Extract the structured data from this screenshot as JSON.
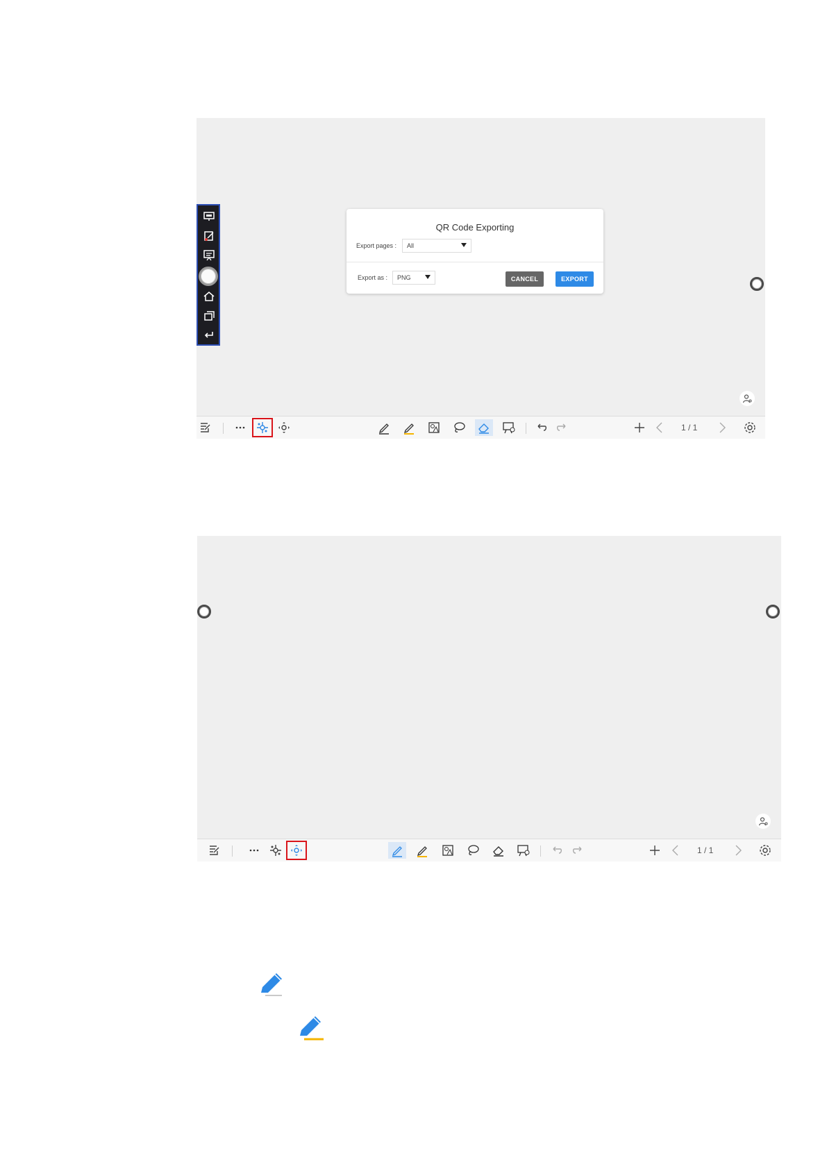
{
  "dialog": {
    "title": "QR Code Exporting",
    "export_pages_label": "Export pages :",
    "export_pages_value": "All",
    "export_as_label": "Export as :",
    "export_as_value": "PNG",
    "cancel_label": "CANCEL",
    "export_label": "EXPORT"
  },
  "toolbar": {
    "page_indicator": "1 / 1"
  },
  "colors": {
    "canvas": "#efefef",
    "accent_blue": "#2e8ae6",
    "highlight_red": "#d9141a",
    "sidebar_bg": "#1d1d22",
    "sidebar_border": "#2d4fb5",
    "highlighter_yellow": "#f5b400"
  },
  "icons": {
    "sidebar": [
      "annotate-icon",
      "note-icon",
      "whiteboard-icon",
      "home-icon",
      "windows-icon",
      "back-icon"
    ],
    "toolbar": [
      "notes-icon",
      "more-icon",
      "select-icon",
      "move-icon",
      "pen-icon",
      "highlighter-icon",
      "shape-icon",
      "lasso-icon",
      "eraser-icon",
      "present-icon",
      "undo-icon",
      "redo-icon",
      "add-page-icon",
      "prev-page-icon",
      "next-page-icon",
      "settings-icon"
    ],
    "standalone": [
      "pen-icon-blue",
      "highlighter-icon-blue"
    ]
  }
}
